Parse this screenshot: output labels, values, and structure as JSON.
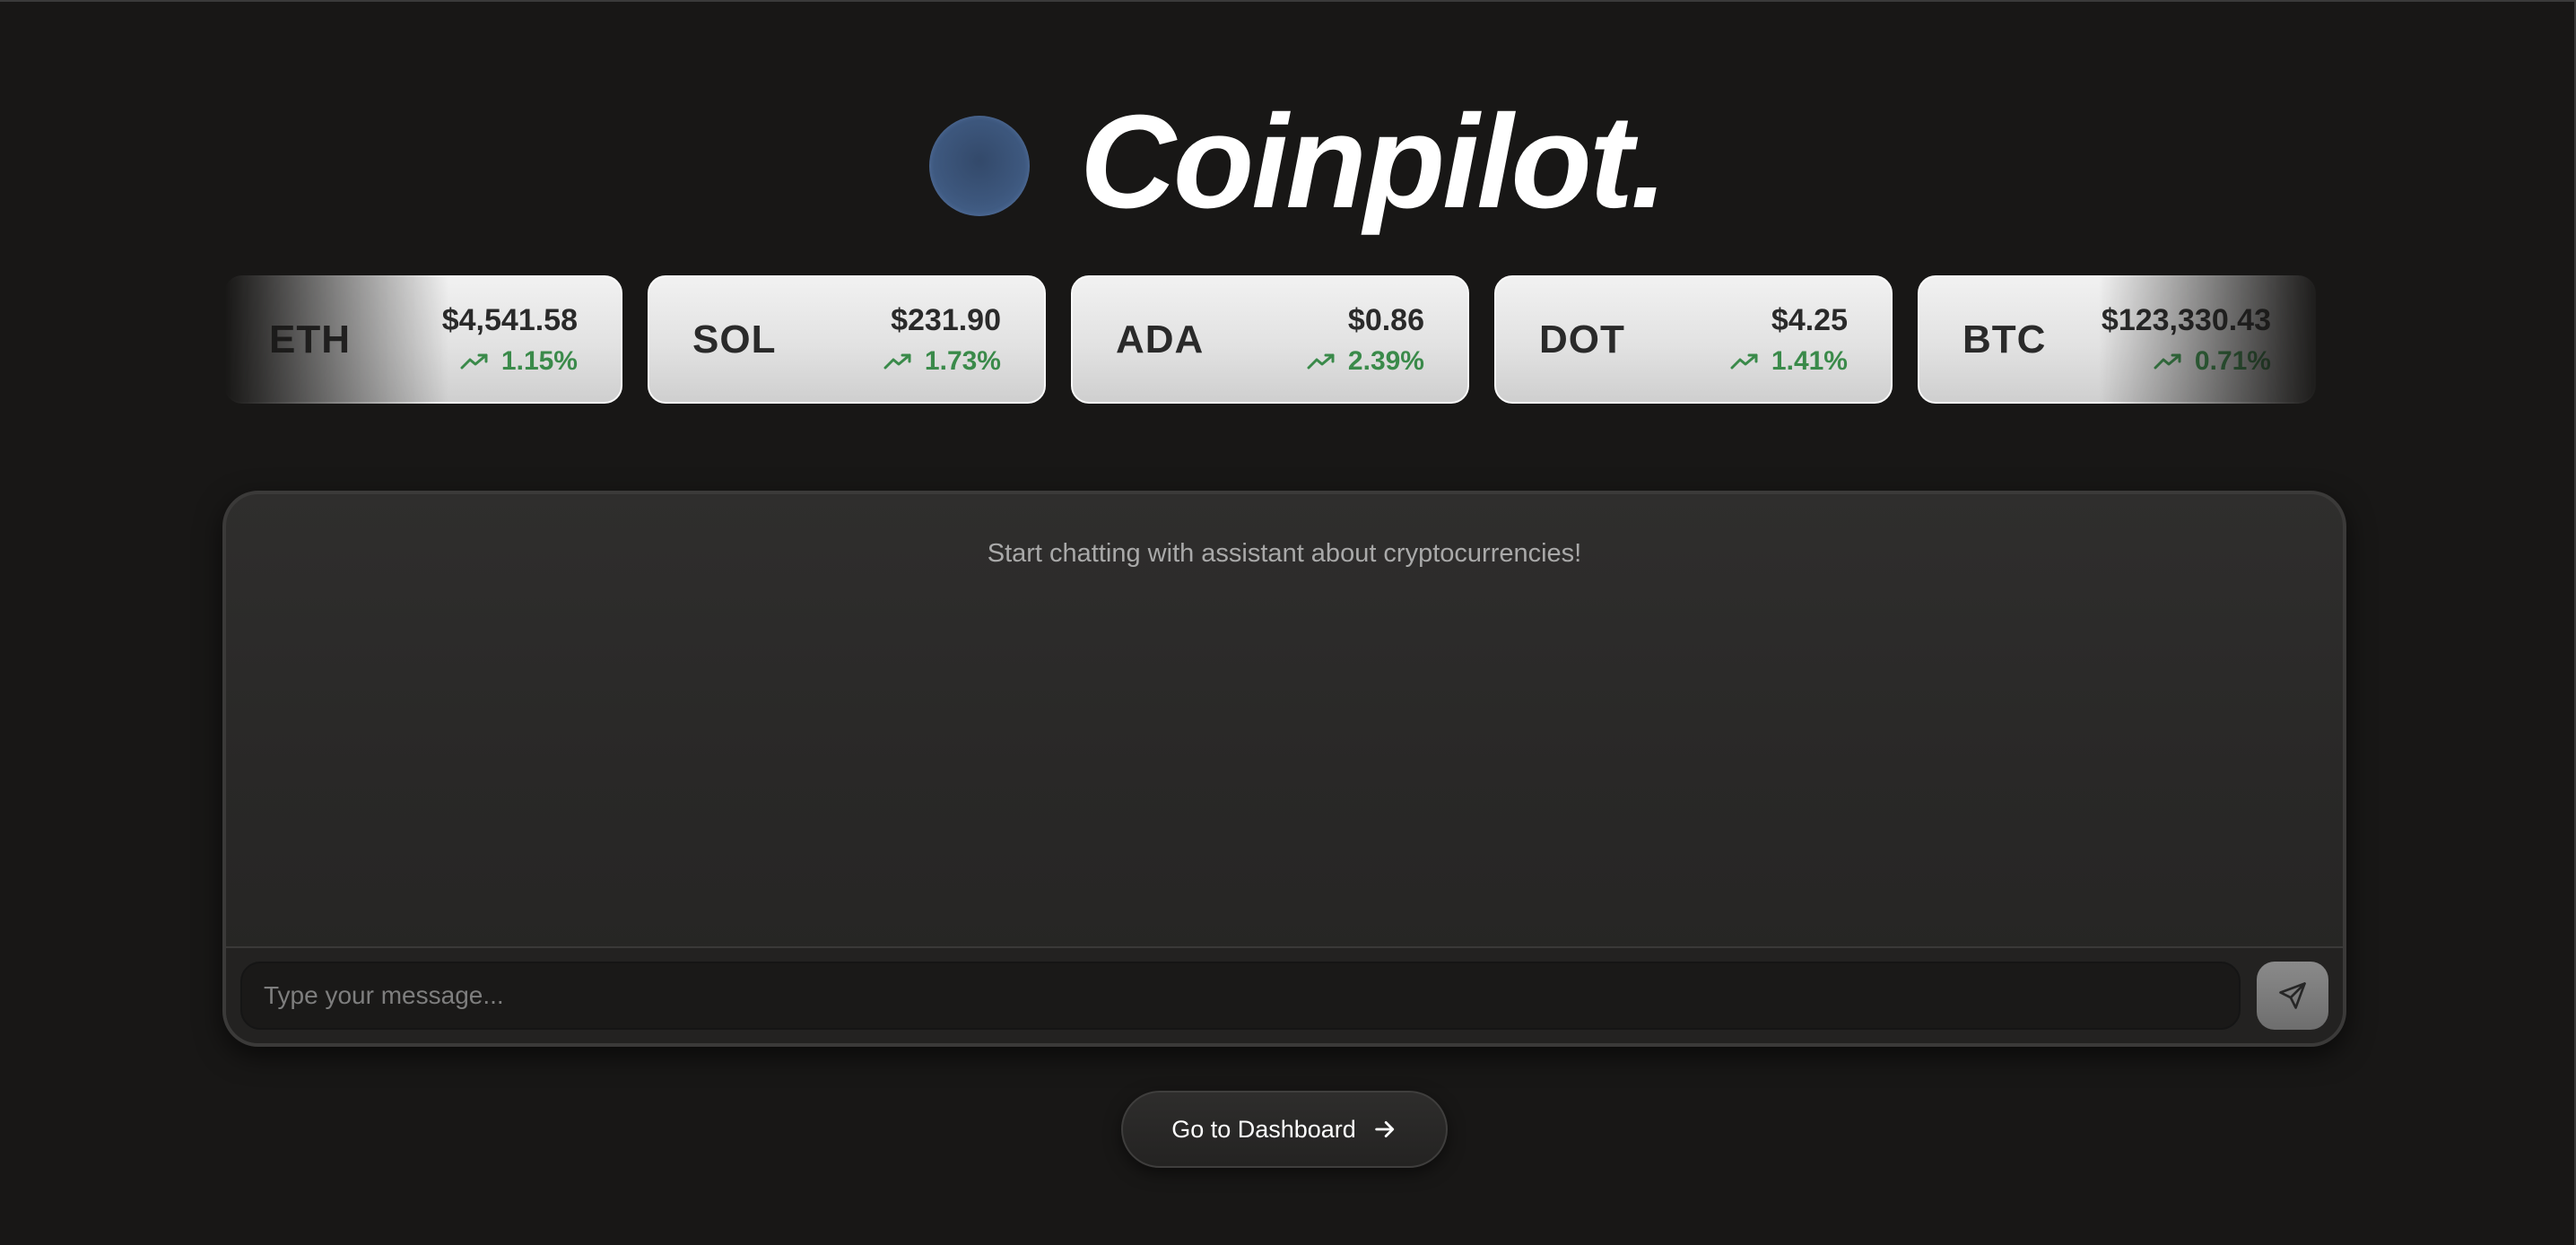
{
  "brand": {
    "name": "Coinpilot.",
    "logo_color": "#3d577d"
  },
  "ticker": {
    "change_color": "#3a8a4a",
    "coins": [
      {
        "symbol": "ETH",
        "price": "$4,541.58",
        "change": "1.15%",
        "trend_icon": "trending-up-icon"
      },
      {
        "symbol": "SOL",
        "price": "$231.90",
        "change": "1.73%",
        "trend_icon": "trending-up-icon"
      },
      {
        "symbol": "ADA",
        "price": "$0.86",
        "change": "2.39%",
        "trend_icon": "trending-up-icon"
      },
      {
        "symbol": "DOT",
        "price": "$4.25",
        "change": "1.41%",
        "trend_icon": "trending-up-icon"
      },
      {
        "symbol": "BTC",
        "price": "$123,330.43",
        "change": "0.71%",
        "trend_icon": "trending-up-icon"
      }
    ]
  },
  "chat": {
    "empty_message": "Start chatting with assistant about cryptocurrencies!",
    "input_value": "",
    "input_placeholder": "Type your message...",
    "send_icon": "send-icon"
  },
  "dashboard_button": {
    "label": "Go to Dashboard",
    "icon": "arrow-right-icon"
  }
}
